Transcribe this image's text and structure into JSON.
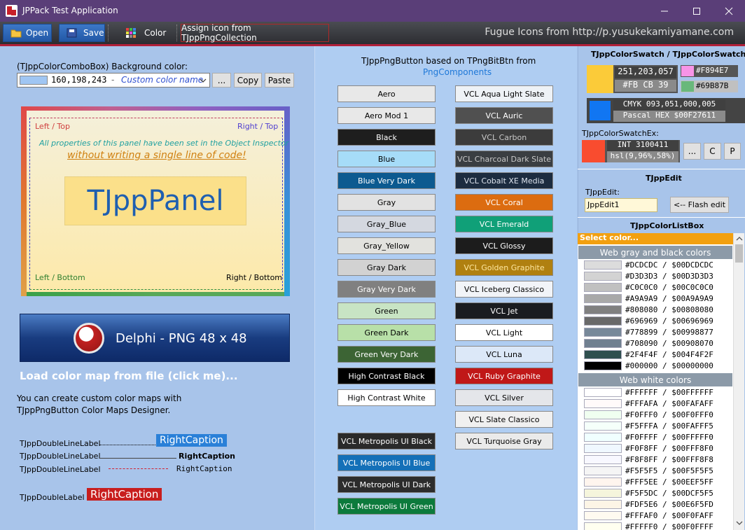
{
  "window": {
    "title": "JPPack Test Application",
    "minimize_icon": "minimize-icon",
    "maximize_icon": "maximize-icon",
    "close_icon": "close-icon"
  },
  "toolbar": {
    "open_label": "Open",
    "save_label": "Save",
    "color_label": "Color",
    "assign_label": "Assign icon from TJppPngCollection",
    "fugue_text": "Fugue Icons from http://p.yusukekamiyamane.com"
  },
  "left": {
    "combo_caption": "(TJppColorComboBox) Background color:",
    "combo_value": "160,198,243",
    "combo_sep": "-",
    "combo_name": "Custom color name",
    "ellipsis_label": "...",
    "copy_label": "Copy",
    "paste_label": "Paste",
    "panel": {
      "left_top": "Left / Top",
      "right_top": "Right / Top",
      "left_bottom": "Left / Bottom",
      "right_bottom": "Right / Bottom",
      "line1": "All properties of this panel have been set in the Object Inspector",
      "line2": "without writing a single line of code!",
      "caption": "TJppPanel"
    },
    "delphi_caption": "Delphi - PNG 48 x 48",
    "load_link": "Load color map from file (click me)...",
    "info_line1": "You can create custom color maps with",
    "info_line2": "TJppPngButton Color Maps Designer.",
    "dl_label": "TJppDoubleLineLabel",
    "dl1_right": "RightCaption",
    "dl2_right": "RightCaption",
    "dl3_right": "RightCaption",
    "dl4_label": "TJppDoubleLabel",
    "dl4_right": "RightCaption"
  },
  "middle": {
    "title_line1": "TJppPngButton based on TPngBitBtn from",
    "title_link": "PngComponents",
    "col1": [
      {
        "label": "Aero",
        "bg": "#e8e8e8",
        "fg": "#000000"
      },
      {
        "label": "Aero Mod 1",
        "bg": "#e8e8e8",
        "fg": "#000000"
      },
      {
        "label": "Black",
        "bg": "#1e1e1e",
        "fg": "#ffffff"
      },
      {
        "label": "Blue",
        "bg": "#a6dcf8",
        "fg": "#000000"
      },
      {
        "label": "Blue Very Dark",
        "bg": "#0c5a90",
        "fg": "#ffffff"
      },
      {
        "label": "Gray",
        "bg": "#e2e2e2",
        "fg": "#000000"
      },
      {
        "label": "Gray_Blue",
        "bg": "#d4d8e0",
        "fg": "#000000"
      },
      {
        "label": "Gray_Yellow",
        "bg": "#e2e2de",
        "fg": "#000000"
      },
      {
        "label": "Gray Dark",
        "bg": "#d2d2d2",
        "fg": "#000000"
      },
      {
        "label": "Gray Very Dark",
        "bg": "#808080",
        "fg": "#ffffff"
      },
      {
        "label": "Green",
        "bg": "#c8e4c4",
        "fg": "#000000"
      },
      {
        "label": "Green Dark",
        "bg": "#b8e0a8",
        "fg": "#000000"
      },
      {
        "label": "Green Very Dark",
        "bg": "#3c6434",
        "fg": "#ffffff"
      },
      {
        "label": "High Contrast Black",
        "bg": "#000000",
        "fg": "#ffffff"
      },
      {
        "label": "High Contrast White",
        "bg": "#ffffff",
        "fg": "#000000"
      }
    ],
    "col1b": [
      {
        "label": "VCL Metropolis UI Black",
        "bg": "#2a2a2a",
        "fg": "#ffffff"
      },
      {
        "label": "VCL Metropolis UI Blue",
        "bg": "#1470b8",
        "fg": "#ffffff"
      },
      {
        "label": "VCL Metropolis UI Dark",
        "bg": "#2c2c2c",
        "fg": "#ffffff"
      },
      {
        "label": "VCL Metropolis UI Green",
        "bg": "#0c7a3c",
        "fg": "#ffffff"
      }
    ],
    "col2": [
      {
        "label": "VCL Aqua Light Slate",
        "bg": "#eef2f6",
        "fg": "#000000"
      },
      {
        "label": "VCL Auric",
        "bg": "#505050",
        "fg": "#ffffff"
      },
      {
        "label": "VCL Carbon",
        "bg": "#3c3c3c",
        "fg": "#c8c8c8"
      },
      {
        "label": "VCL Charcoal Dark Slate",
        "bg": "#3a3e42",
        "fg": "#c8c8c8"
      },
      {
        "label": "VCL Cobalt XE Media",
        "bg": "#1c2c40",
        "fg": "#dde4ee"
      },
      {
        "label": "VCL Coral",
        "bg": "#dc6c10",
        "fg": "#ffffff"
      },
      {
        "label": "VCL Emerald",
        "bg": "#10a078",
        "fg": "#ffffff"
      },
      {
        "label": "VCL Glossy",
        "bg": "#1c1c1c",
        "fg": "#ffffff"
      },
      {
        "label": "VCL Golden Graphite",
        "bg": "#b08010",
        "fg": "#ffe8a0"
      },
      {
        "label": "VCL Iceberg Classico",
        "bg": "#f2f4f8",
        "fg": "#000000"
      },
      {
        "label": "VCL Jet",
        "bg": "#1a1c20",
        "fg": "#ffffff"
      },
      {
        "label": "VCL Light",
        "bg": "#ffffff",
        "fg": "#000000"
      },
      {
        "label": "VCL Luna",
        "bg": "#dce8f8",
        "fg": "#000000"
      },
      {
        "label": "VCL Ruby Graphite",
        "bg": "#c01818",
        "fg": "#ffffff"
      },
      {
        "label": "VCL Silver",
        "bg": "#e4e6ea",
        "fg": "#000000"
      },
      {
        "label": "VCL Slate Classico",
        "bg": "#f0f0f0",
        "fg": "#000000"
      },
      {
        "label": "VCL Turquoise Gray",
        "bg": "#eaeaea",
        "fg": "#000000"
      }
    ]
  },
  "right": {
    "swatch_title": "TJppColorSwatch / TJppColorSwatchEx",
    "swatch1_rgb": "251,203,057",
    "swatch1_hex": "#FB CB 39",
    "swatch1_color": "#fbcb39",
    "chip1_text": "#F894E7",
    "chip1_color": "#f894e7",
    "chip2_text": "#69B87B",
    "chip2_color": "#69b87b",
    "swatch2_cmyk": "CMYK 093,051,000,005",
    "swatch2_pascal": "Pascal HEX $00F27611",
    "swatch2_color": "#1176f2",
    "swatchex_title": "TJppColorSwatchEx:",
    "swatch3_int": "INT 3100411",
    "swatch3_hsl": "hsl(9,96%,58%)",
    "swatch3_color": "#f94c2f",
    "btn_dots": "...",
    "btn_c": "C",
    "btn_p": "P",
    "edit_title": "TJppEdit",
    "edit_caption": "TJppEdit:",
    "edit_value": "JppEdit1",
    "flash_label": "<-- Flash edit",
    "listbox_title": "TJppColorListBox",
    "select_label": "Select color...",
    "group1": "Web gray and black colors",
    "items1": [
      {
        "text": "#DCDCDC / $00DCDCDC",
        "color": "#dcdcdc"
      },
      {
        "text": "#D3D3D3 / $00D3D3D3",
        "color": "#d3d3d3"
      },
      {
        "text": "#C0C0C0 / $00C0C0C0",
        "color": "#c0c0c0"
      },
      {
        "text": "#A9A9A9 / $00A9A9A9",
        "color": "#a9a9a9"
      },
      {
        "text": "#808080 / $00808080",
        "color": "#808080"
      },
      {
        "text": "#696969 / $00696969",
        "color": "#696969"
      },
      {
        "text": "#778899 / $00998877",
        "color": "#778899"
      },
      {
        "text": "#708090 / $00908070",
        "color": "#708090"
      },
      {
        "text": "#2F4F4F / $004F4F2F",
        "color": "#2f4f4f"
      },
      {
        "text": "#000000 / $00000000",
        "color": "#000000"
      }
    ],
    "group2": "Web white colors",
    "items2": [
      {
        "text": "#FFFFFF / $00FFFFFF",
        "color": "#ffffff"
      },
      {
        "text": "#FFFAFA / $00FAFAFF",
        "color": "#fffafa"
      },
      {
        "text": "#F0FFF0 / $00F0FFF0",
        "color": "#f0fff0"
      },
      {
        "text": "#F5FFFA / $00FAFFF5",
        "color": "#f5fffa"
      },
      {
        "text": "#F0FFFF / $00FFFFF0",
        "color": "#f0ffff"
      },
      {
        "text": "#F0F8FF / $00FFF8F0",
        "color": "#f0f8ff"
      },
      {
        "text": "#F8F8FF / $00FFF8F8",
        "color": "#f8f8ff"
      },
      {
        "text": "#F5F5F5 / $00F5F5F5",
        "color": "#f5f5f5"
      },
      {
        "text": "#FFF5EE / $00EEF5FF",
        "color": "#fff5ee"
      },
      {
        "text": "#F5F5DC / $00DCF5F5",
        "color": "#f5f5dc"
      },
      {
        "text": "#FDF5E6 / $00E6F5FD",
        "color": "#fdf5e6"
      },
      {
        "text": "#FFFAF0 / $00F0FAFF",
        "color": "#fffaf0"
      },
      {
        "text": "#FFFFF0 / $00F0FFFF",
        "color": "#fffff0"
      }
    ]
  }
}
